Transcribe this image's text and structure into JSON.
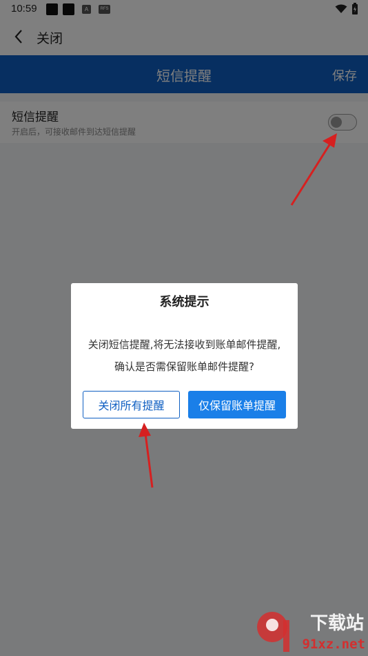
{
  "status_bar": {
    "time": "10:59",
    "small_badge_a": "A",
    "small_badge_b": "RFS"
  },
  "top_nav": {
    "back_icon": "chevron-left-icon",
    "label": "关闭"
  },
  "header": {
    "title": "短信提醒",
    "save_label": "保存",
    "color": "#0f5fc2"
  },
  "setting_row": {
    "title": "短信提醒",
    "subtitle": "开启后，可接收邮件到达短信提醒",
    "toggle_on": false
  },
  "dialog": {
    "title": "系统提示",
    "line1": "关闭短信提醒,将无法接收到账单邮件提醒,",
    "line2": "确认是否需保留账单邮件提醒?",
    "button_close_all": "关闭所有提醒",
    "button_keep_bill": "仅保留账单提醒",
    "primary_color": "#1a7fe8"
  },
  "watermark": {
    "top": "下载站",
    "bottom": "91xz.net"
  }
}
